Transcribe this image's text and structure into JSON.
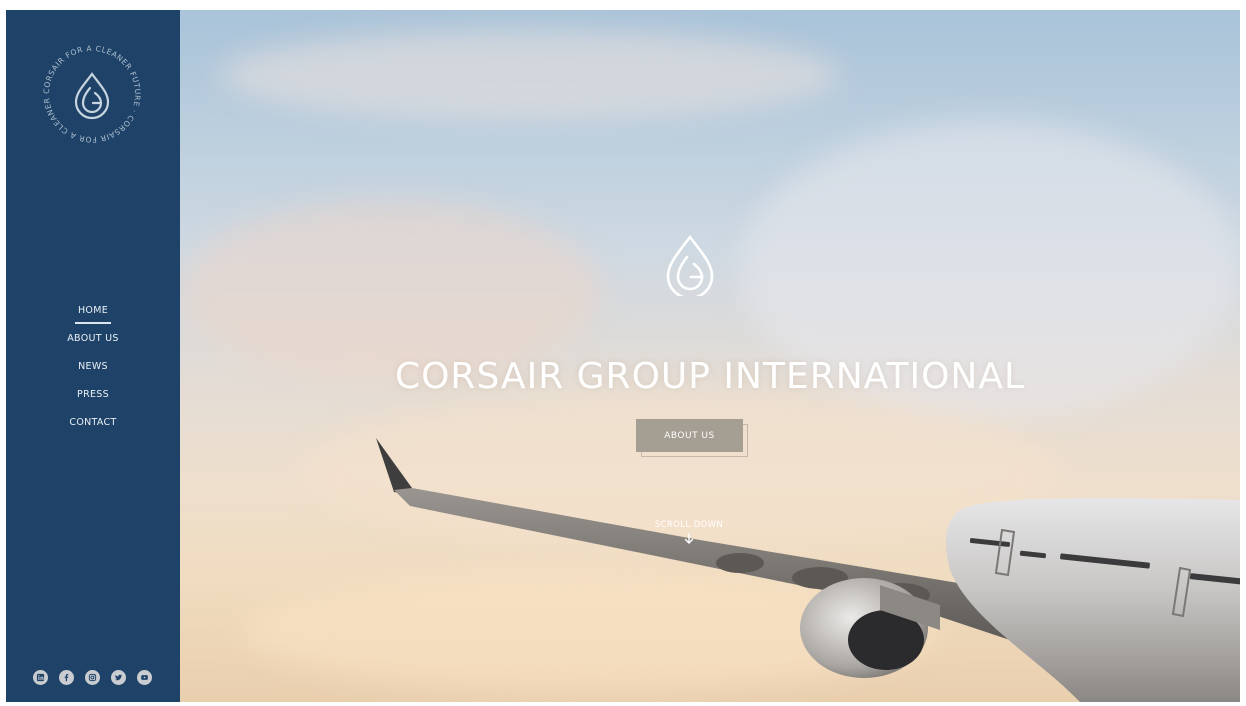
{
  "brand": {
    "name": "CORSAIR GROUP INTERNATIONAL",
    "seal_text": "CORSAIR FOR A CLEANER FUTURE CORSAIR FOR A CLEANER FUTURE"
  },
  "nav": {
    "items": [
      {
        "label": "HOME",
        "active": true
      },
      {
        "label": "ABOUT US",
        "active": false
      },
      {
        "label": "NEWS",
        "active": false
      },
      {
        "label": "PRESS",
        "active": false
      },
      {
        "label": "CONTACT",
        "active": false
      }
    ]
  },
  "hero": {
    "title": "CORSAIR GROUP INTERNATIONAL",
    "cta_label": "ABOUT US",
    "scroll_label": "SCROLL DOWN"
  },
  "socials": [
    {
      "icon": "linkedin-icon"
    },
    {
      "icon": "facebook-icon"
    },
    {
      "icon": "instagram-icon"
    },
    {
      "icon": "twitter-icon"
    },
    {
      "icon": "youtube-icon"
    }
  ],
  "colors": {
    "sidebar": "#1f4368",
    "cta": "#a49e93",
    "text": "#ffffff"
  }
}
